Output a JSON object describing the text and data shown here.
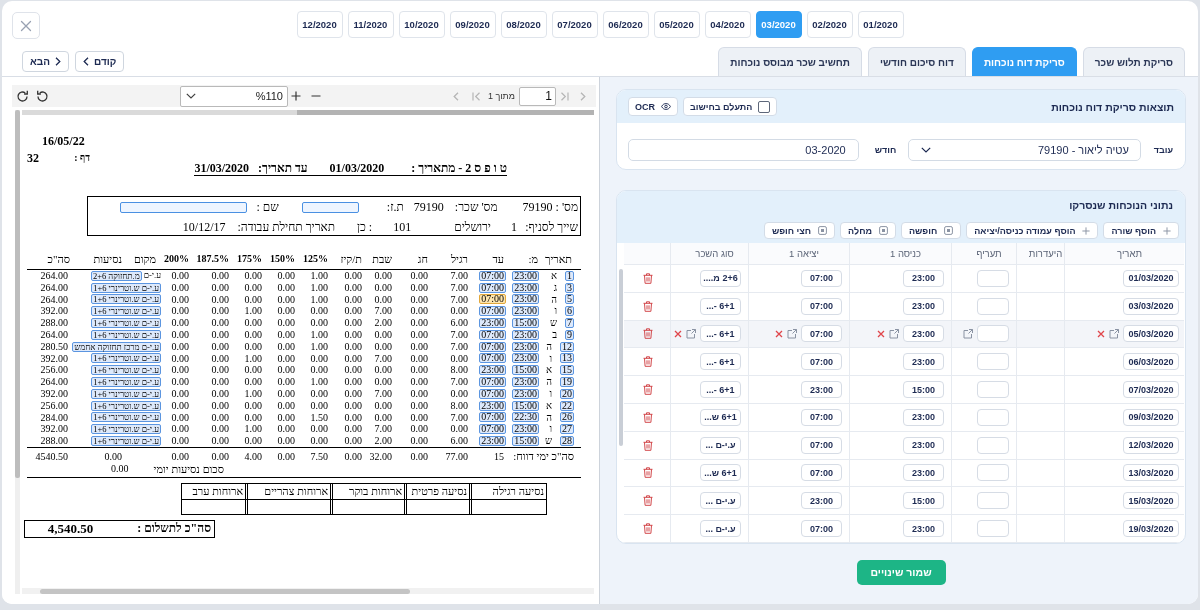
{
  "month_bar": {
    "months": [
      {
        "label": "12/2020",
        "selected": false
      },
      {
        "label": "11/2020",
        "selected": false
      },
      {
        "label": "10/2020",
        "selected": false
      },
      {
        "label": "09/2020",
        "selected": false
      },
      {
        "label": "08/2020",
        "selected": false
      },
      {
        "label": "07/2020",
        "selected": false
      },
      {
        "label": "06/2020",
        "selected": false
      },
      {
        "label": "05/2020",
        "selected": false
      },
      {
        "label": "04/2020",
        "selected": false
      },
      {
        "label": "03/2020",
        "selected": true
      },
      {
        "label": "02/2020",
        "selected": false
      },
      {
        "label": "01/2020",
        "selected": false
      }
    ]
  },
  "tabs": [
    {
      "label": "סריקת תלוש שכר",
      "selected": false
    },
    {
      "label": "סריקת דוח נוכחות",
      "selected": true
    },
    {
      "label": "דוח סיכום חודשי",
      "selected": false
    },
    {
      "label": "תחשיב שכר מבוסס נוכחות",
      "selected": false
    }
  ],
  "nav_buttons": [
    {
      "label": "קודם",
      "kind": "prev"
    },
    {
      "label": "הבא",
      "kind": "next"
    }
  ],
  "scan_results": {
    "title": "תוצאות סריקת דוח נוכחות",
    "ignore_checkbox": {
      "label": "התעלם בחישוב",
      "checked": false
    },
    "ocr_button": {
      "label": "OCR"
    },
    "employee_field": {
      "label": "עובד",
      "value": "עטיה ליאור - 79190"
    },
    "month_field": {
      "label": "חודש",
      "value": "03-2020"
    }
  },
  "attendance": {
    "title": "נתוני הנוכחות שנסרקו",
    "actions": [
      {
        "label": "הוסף שורה",
        "kind": "add"
      },
      {
        "label": "הוסף עמודה כניסה/יציאה",
        "kind": "add"
      },
      {
        "label": "חופשה",
        "kind": "absence"
      },
      {
        "label": "מחלה",
        "kind": "absence"
      },
      {
        "label": "חצי חופש",
        "kind": "absence"
      }
    ],
    "columns": [
      "תאריך",
      "היעדרות",
      "תעריף",
      "כניסה 1",
      "יציאה 1",
      "סוג השכר"
    ],
    "rows": [
      {
        "date": "01/03/2020",
        "entry": "23:00",
        "exit": "07:00",
        "pay_type": "2+6 מ....",
        "selected": false
      },
      {
        "date": "03/03/2020",
        "entry": "23:00",
        "exit": "07:00",
        "pay_type": "6+1 -...",
        "selected": false
      },
      {
        "date": "05/03/2020",
        "entry": "23:00",
        "exit": "07:00",
        "pay_type": "6+1 -...",
        "selected": true
      },
      {
        "date": "06/03/2020",
        "entry": "23:00",
        "exit": "07:00",
        "pay_type": "6+1 -...",
        "selected": false
      },
      {
        "date": "07/03/2020",
        "entry": "15:00",
        "exit": "23:00",
        "pay_type": "6+1 -...",
        "selected": false
      },
      {
        "date": "09/03/2020",
        "entry": "23:00",
        "exit": "07:00",
        "pay_type": "6+1 ש...",
        "selected": false
      },
      {
        "date": "12/03/2020",
        "entry": "23:00",
        "exit": "07:00",
        "pay_type": "ע.י-ם ...",
        "selected": false
      },
      {
        "date": "13/03/2020",
        "entry": "23:00",
        "exit": "07:00",
        "pay_type": "6+1 ש...",
        "selected": false
      },
      {
        "date": "15/03/2020",
        "entry": "15:00",
        "exit": "23:00",
        "pay_type": "ע.י-ם ...",
        "selected": false
      },
      {
        "date": "19/03/2020",
        "entry": "23:00",
        "exit": "07:00",
        "pay_type": "ע.י-ם ...",
        "selected": false
      }
    ]
  },
  "save_button": {
    "label": "שמור שינויים"
  },
  "pdf_viewer": {
    "page_total": "מתוך 1",
    "page_input": "1",
    "zoom": "%110",
    "document": {
      "print_date": "16/05/22",
      "page_label": "דף :",
      "page_number": "32",
      "title": "ט ו פ ס 2 - מתאריך :",
      "from_date": "01/03/2020",
      "to_label": "עד תאריך:",
      "to_date": "31/03/2020",
      "employee_rows": [
        [
          {
            "kind": "label",
            "text": "מס' : 79190"
          },
          {
            "kind": "label",
            "text": "מס' שכר:"
          },
          {
            "kind": "value",
            "text": "79190"
          },
          {
            "kind": "label",
            "text": "ת.ז:"
          },
          {
            "kind": "blank"
          },
          {
            "kind": "label",
            "text": "שם :"
          },
          {
            "kind": "blank"
          }
        ],
        [
          {
            "kind": "label",
            "text": "שייך לסניף:"
          },
          {
            "kind": "value",
            "text": "1"
          },
          {
            "kind": "value",
            "text": "ירושלים"
          },
          {
            "kind": "value",
            "text": "101"
          },
          {
            "kind": "value",
            "text": ": כן"
          },
          {
            "kind": "label",
            "text": "תאריך תחילת עבודה:"
          },
          {
            "kind": "value",
            "text": "10/12/17"
          }
        ]
      ],
      "table": {
        "columns": [
          {
            "label": "תאריך",
            "kind": "field"
          },
          {
            "label": "מ:",
            "kind": "field"
          },
          {
            "label": "עד",
            "kind": "field"
          },
          {
            "label": "רגיל",
            "kind": "field"
          },
          {
            "label": "חג",
            "kind": "field"
          },
          {
            "label": "שבת",
            "kind": "field"
          },
          {
            "label": "ת/קיז",
            "kind": "field"
          },
          {
            "label": "125%",
            "kind": "rate"
          },
          {
            "label": "150%",
            "kind": "rate"
          },
          {
            "label": "175%",
            "kind": "rate"
          },
          {
            "label": "187.5%",
            "kind": "rate"
          },
          {
            "label": "200%",
            "kind": "rate"
          },
          {
            "label": "מקום",
            "kind": "field"
          },
          {
            "label": "נסיעות",
            "kind": "field"
          },
          {
            "label": "סה\"כ",
            "kind": "field"
          }
        ],
        "rows": [
          {
            "date": "1",
            "day": "א",
            "from": "23:00",
            "to": "07:00",
            "to_selected": false,
            "hours": [
              "0.00",
              "0.00",
              "0.00",
              "0.00",
              "1.00",
              "0.00",
              "0.00",
              "0.00",
              "7.00"
            ],
            "place": [
              {
                "text": "ע.י-ם",
                "boxed": false
              },
              {
                "text": "מ.תחזוקה 2+6",
                "boxed": true
              }
            ],
            "total": "264.00"
          },
          {
            "date": "3",
            "day": "ג",
            "from": "23:00",
            "to": "07:00",
            "to_selected": false,
            "hours": [
              "0.00",
              "0.00",
              "0.00",
              "0.00",
              "1.00",
              "0.00",
              "0.00",
              "0.00",
              "7.00"
            ],
            "place": [
              {
                "text": "ע.י-ם ש.וטרינרי 1+6",
                "boxed": true
              }
            ],
            "total": "264.00"
          },
          {
            "date": "5",
            "day": "ה",
            "from": "23:00",
            "to": "07:00",
            "to_selected": true,
            "hours": [
              "0.00",
              "0.00",
              "0.00",
              "0.00",
              "1.00",
              "0.00",
              "0.00",
              "0.00",
              "7.00"
            ],
            "place": [
              {
                "text": "ע.י-ם ש.וטרינרי 1+6",
                "boxed": true
              }
            ],
            "total": "264.00"
          },
          {
            "date": "6",
            "day": "ו",
            "from": "23:00",
            "to": "07:00",
            "to_selected": false,
            "hours": [
              "0.00",
              "0.00",
              "1.00",
              "0.00",
              "0.00",
              "0.00",
              "7.00",
              "0.00",
              "0.00"
            ],
            "place": [
              {
                "text": "ע.י-ם ש.וטרינרי 1+6",
                "boxed": true
              }
            ],
            "total": "392.00"
          },
          {
            "date": "7",
            "day": "ש",
            "from": "15:00",
            "to": "23:00",
            "to_selected": false,
            "hours": [
              "0.00",
              "0.00",
              "0.00",
              "0.00",
              "0.00",
              "0.00",
              "2.00",
              "0.00",
              "6.00"
            ],
            "place": [
              {
                "text": "ע.י-ם ש.וטרינרי 1+6",
                "boxed": true
              }
            ],
            "total": "288.00"
          },
          {
            "date": "9",
            "day": "ב",
            "from": "23:00",
            "to": "07:00",
            "to_selected": false,
            "hours": [
              "0.00",
              "0.00",
              "0.00",
              "0.00",
              "1.00",
              "0.00",
              "0.00",
              "0.00",
              "7.00"
            ],
            "place": [
              {
                "text": "ע.י-ם ש.וטרינרי 1+6",
                "boxed": true
              }
            ],
            "total": "264.00"
          },
          {
            "date": "12",
            "day": "ה",
            "from": "23:00",
            "to": "07:00",
            "to_selected": false,
            "hours": [
              "0.00",
              "0.00",
              "0.00",
              "0.00",
              "1.00",
              "0.00",
              "0.00",
              "0.00",
              "7.00"
            ],
            "place": [
              {
                "text": "ע.י-ם מרכז תחזוקה אחמש",
                "boxed": true
              }
            ],
            "total": "280.50"
          },
          {
            "date": "13",
            "day": "ו",
            "from": "23:00",
            "to": "07:00",
            "to_selected": false,
            "hours": [
              "0.00",
              "0.00",
              "1.00",
              "0.00",
              "0.00",
              "0.00",
              "7.00",
              "0.00",
              "0.00"
            ],
            "place": [
              {
                "text": "ע.י-ם ש.וטרינרי 1+6",
                "boxed": true
              }
            ],
            "total": "392.00"
          },
          {
            "date": "15",
            "day": "א",
            "from": "15:00",
            "to": "23:00",
            "to_selected": false,
            "hours": [
              "0.00",
              "0.00",
              "0.00",
              "0.00",
              "0.00",
              "0.00",
              "0.00",
              "0.00",
              "8.00"
            ],
            "place": [
              {
                "text": "ע.י-ם ש.וטרינרי 1+6",
                "boxed": true
              }
            ],
            "total": "256.00"
          },
          {
            "date": "19",
            "day": "ה",
            "from": "23:00",
            "to": "07:00",
            "to_selected": false,
            "hours": [
              "0.00",
              "0.00",
              "0.00",
              "0.00",
              "1.00",
              "0.00",
              "0.00",
              "0.00",
              "7.00"
            ],
            "place": [
              {
                "text": "ע.י-ם ש.וטרינרי 1+6",
                "boxed": true
              }
            ],
            "total": "264.00"
          },
          {
            "date": "20",
            "day": "ו",
            "from": "23:00",
            "to": "07:00",
            "to_selected": false,
            "hours": [
              "0.00",
              "0.00",
              "1.00",
              "0.00",
              "0.00",
              "0.00",
              "7.00",
              "0.00",
              "0.00"
            ],
            "place": [
              {
                "text": "ע.י-ם ש.וטרינרי 1+6",
                "boxed": true
              }
            ],
            "total": "392.00"
          },
          {
            "date": "22",
            "day": "א",
            "from": "15:00",
            "to": "23:00",
            "to_selected": false,
            "hours": [
              "0.00",
              "0.00",
              "0.00",
              "0.00",
              "0.00",
              "0.00",
              "0.00",
              "0.00",
              "8.00"
            ],
            "place": [
              {
                "text": "ע.י-ם ש.וטרינרי 1+6",
                "boxed": true
              }
            ],
            "total": "256.00"
          },
          {
            "date": "26",
            "day": "ה",
            "from": "22:30",
            "to": "07:00",
            "to_selected": false,
            "hours": [
              "0.00",
              "0.00",
              "0.00",
              "0.00",
              "1.50",
              "0.00",
              "0.00",
              "0.00",
              "7.00"
            ],
            "place": [
              {
                "text": "ע.י-ם ש.וטרינרי 1+6",
                "boxed": true
              }
            ],
            "total": "284.00"
          },
          {
            "date": "27",
            "day": "ו",
            "from": "23:00",
            "to": "07:00",
            "to_selected": false,
            "hours": [
              "0.00",
              "0.00",
              "1.00",
              "0.00",
              "0.00",
              "0.00",
              "7.00",
              "0.00",
              "0.00"
            ],
            "place": [
              {
                "text": "ע.י-ם ש.וטרינרי 1+6",
                "boxed": true
              }
            ],
            "total": "392.00"
          },
          {
            "date": "28",
            "day": "ש",
            "from": "15:00",
            "to": "23:00",
            "to_selected": false,
            "hours": [
              "0.00",
              "0.00",
              "0.00",
              "0.00",
              "0.00",
              "0.00",
              "2.00",
              "0.00",
              "6.00"
            ],
            "place": [
              {
                "text": "ע.י-ם ש.וטרינרי 1+6",
                "boxed": true
              }
            ],
            "total": "288.00"
          }
        ],
        "totals": {
          "label": "סה\"כ ימי דווח:",
          "days": "15",
          "hours": [
            "0.00",
            "0.00",
            "4.00",
            "0.00",
            "7.50",
            "0.00",
            "32.00",
            "0.00",
            "77.00"
          ],
          "trips": "0.00",
          "total": "4540.50"
        }
      },
      "trips_sum": {
        "label": "סכום נסיעות יומי",
        "value": "0.00"
      },
      "expenses_table": {
        "columns": [
          "נסיעה רגילה",
          "נסיעה פרטית",
          "ארוחות בוקר",
          "ארוחות צהריים",
          "ארוחות ערב"
        ]
      },
      "grand_total": {
        "label": "סה\"כ לתשלום :",
        "value": "4,540.50"
      }
    }
  }
}
